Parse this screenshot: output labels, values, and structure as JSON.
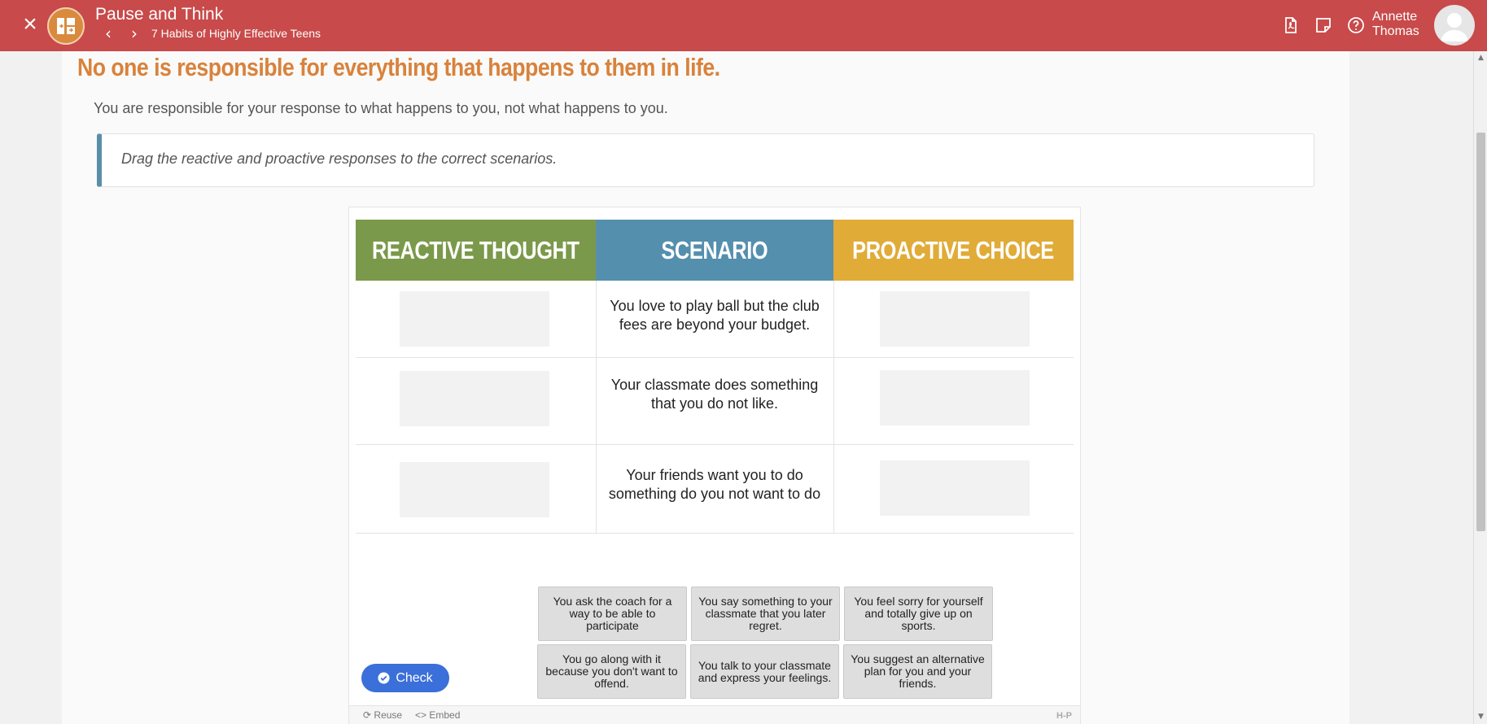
{
  "header": {
    "close_icon": "×",
    "title": "Pause and Think",
    "prev_icon": "‹",
    "next_icon": "›",
    "course": "7 Habits of Highly Effective Teens",
    "user_first": "Annette",
    "user_last": "Thomas",
    "icons": [
      "pdf-icon",
      "notes-icon",
      "help-icon"
    ]
  },
  "main": {
    "headline": "No one is responsible for everything that happens to them in life.",
    "subline": "You are responsible for your response to what happens to you, not what happens to you.",
    "instruction": "Drag the reactive and proactive responses to the correct scenarios."
  },
  "activity": {
    "columns": {
      "reactive": "REACTIVE THOUGHT",
      "scenario": "SCENARIO",
      "proactive": "PROACTIVE CHOICE"
    },
    "scenarios": [
      "You love to play ball but the club fees are beyond your budget.",
      "Your classmate does something that you do not like.",
      "Your friends want you to do something do you not want to do"
    ],
    "drag_items": [
      "You ask the coach for a way to be able to participate",
      "You say something to your classmate that you later regret.",
      "You feel sorry for yourself and totally give up on sports.",
      "You go along with it because you don't want to offend.",
      "You talk to your classmate and express your feelings.",
      "You suggest an alternative plan for you and your friends."
    ],
    "check_label": "Check",
    "reuse_label": "Reuse",
    "embed_label": "Embed",
    "h5p_logo": "H-P"
  },
  "colors": {
    "topbar": "#c84a4a",
    "headline": "#d9823b",
    "reactive": "#7b994a",
    "scenario": "#548fae",
    "proactive": "#e0ab37",
    "check_button": "#3b6fd9"
  }
}
